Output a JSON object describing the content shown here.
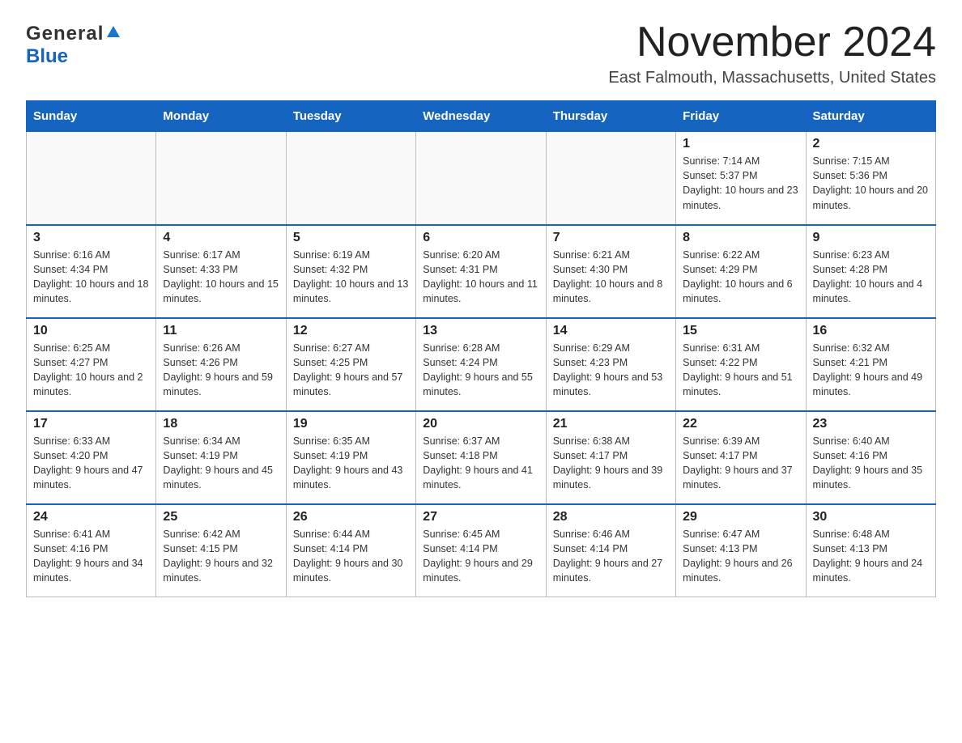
{
  "header": {
    "logo_general": "General",
    "logo_blue": "Blue",
    "month_title": "November 2024",
    "location": "East Falmouth, Massachusetts, United States"
  },
  "weekdays": [
    "Sunday",
    "Monday",
    "Tuesday",
    "Wednesday",
    "Thursday",
    "Friday",
    "Saturday"
  ],
  "weeks": [
    [
      {
        "day": "",
        "info": ""
      },
      {
        "day": "",
        "info": ""
      },
      {
        "day": "",
        "info": ""
      },
      {
        "day": "",
        "info": ""
      },
      {
        "day": "",
        "info": ""
      },
      {
        "day": "1",
        "info": "Sunrise: 7:14 AM\nSunset: 5:37 PM\nDaylight: 10 hours and 23 minutes."
      },
      {
        "day": "2",
        "info": "Sunrise: 7:15 AM\nSunset: 5:36 PM\nDaylight: 10 hours and 20 minutes."
      }
    ],
    [
      {
        "day": "3",
        "info": "Sunrise: 6:16 AM\nSunset: 4:34 PM\nDaylight: 10 hours and 18 minutes."
      },
      {
        "day": "4",
        "info": "Sunrise: 6:17 AM\nSunset: 4:33 PM\nDaylight: 10 hours and 15 minutes."
      },
      {
        "day": "5",
        "info": "Sunrise: 6:19 AM\nSunset: 4:32 PM\nDaylight: 10 hours and 13 minutes."
      },
      {
        "day": "6",
        "info": "Sunrise: 6:20 AM\nSunset: 4:31 PM\nDaylight: 10 hours and 11 minutes."
      },
      {
        "day": "7",
        "info": "Sunrise: 6:21 AM\nSunset: 4:30 PM\nDaylight: 10 hours and 8 minutes."
      },
      {
        "day": "8",
        "info": "Sunrise: 6:22 AM\nSunset: 4:29 PM\nDaylight: 10 hours and 6 minutes."
      },
      {
        "day": "9",
        "info": "Sunrise: 6:23 AM\nSunset: 4:28 PM\nDaylight: 10 hours and 4 minutes."
      }
    ],
    [
      {
        "day": "10",
        "info": "Sunrise: 6:25 AM\nSunset: 4:27 PM\nDaylight: 10 hours and 2 minutes."
      },
      {
        "day": "11",
        "info": "Sunrise: 6:26 AM\nSunset: 4:26 PM\nDaylight: 9 hours and 59 minutes."
      },
      {
        "day": "12",
        "info": "Sunrise: 6:27 AM\nSunset: 4:25 PM\nDaylight: 9 hours and 57 minutes."
      },
      {
        "day": "13",
        "info": "Sunrise: 6:28 AM\nSunset: 4:24 PM\nDaylight: 9 hours and 55 minutes."
      },
      {
        "day": "14",
        "info": "Sunrise: 6:29 AM\nSunset: 4:23 PM\nDaylight: 9 hours and 53 minutes."
      },
      {
        "day": "15",
        "info": "Sunrise: 6:31 AM\nSunset: 4:22 PM\nDaylight: 9 hours and 51 minutes."
      },
      {
        "day": "16",
        "info": "Sunrise: 6:32 AM\nSunset: 4:21 PM\nDaylight: 9 hours and 49 minutes."
      }
    ],
    [
      {
        "day": "17",
        "info": "Sunrise: 6:33 AM\nSunset: 4:20 PM\nDaylight: 9 hours and 47 minutes."
      },
      {
        "day": "18",
        "info": "Sunrise: 6:34 AM\nSunset: 4:19 PM\nDaylight: 9 hours and 45 minutes."
      },
      {
        "day": "19",
        "info": "Sunrise: 6:35 AM\nSunset: 4:19 PM\nDaylight: 9 hours and 43 minutes."
      },
      {
        "day": "20",
        "info": "Sunrise: 6:37 AM\nSunset: 4:18 PM\nDaylight: 9 hours and 41 minutes."
      },
      {
        "day": "21",
        "info": "Sunrise: 6:38 AM\nSunset: 4:17 PM\nDaylight: 9 hours and 39 minutes."
      },
      {
        "day": "22",
        "info": "Sunrise: 6:39 AM\nSunset: 4:17 PM\nDaylight: 9 hours and 37 minutes."
      },
      {
        "day": "23",
        "info": "Sunrise: 6:40 AM\nSunset: 4:16 PM\nDaylight: 9 hours and 35 minutes."
      }
    ],
    [
      {
        "day": "24",
        "info": "Sunrise: 6:41 AM\nSunset: 4:16 PM\nDaylight: 9 hours and 34 minutes."
      },
      {
        "day": "25",
        "info": "Sunrise: 6:42 AM\nSunset: 4:15 PM\nDaylight: 9 hours and 32 minutes."
      },
      {
        "day": "26",
        "info": "Sunrise: 6:44 AM\nSunset: 4:14 PM\nDaylight: 9 hours and 30 minutes."
      },
      {
        "day": "27",
        "info": "Sunrise: 6:45 AM\nSunset: 4:14 PM\nDaylight: 9 hours and 29 minutes."
      },
      {
        "day": "28",
        "info": "Sunrise: 6:46 AM\nSunset: 4:14 PM\nDaylight: 9 hours and 27 minutes."
      },
      {
        "day": "29",
        "info": "Sunrise: 6:47 AM\nSunset: 4:13 PM\nDaylight: 9 hours and 26 minutes."
      },
      {
        "day": "30",
        "info": "Sunrise: 6:48 AM\nSunset: 4:13 PM\nDaylight: 9 hours and 24 minutes."
      }
    ]
  ]
}
